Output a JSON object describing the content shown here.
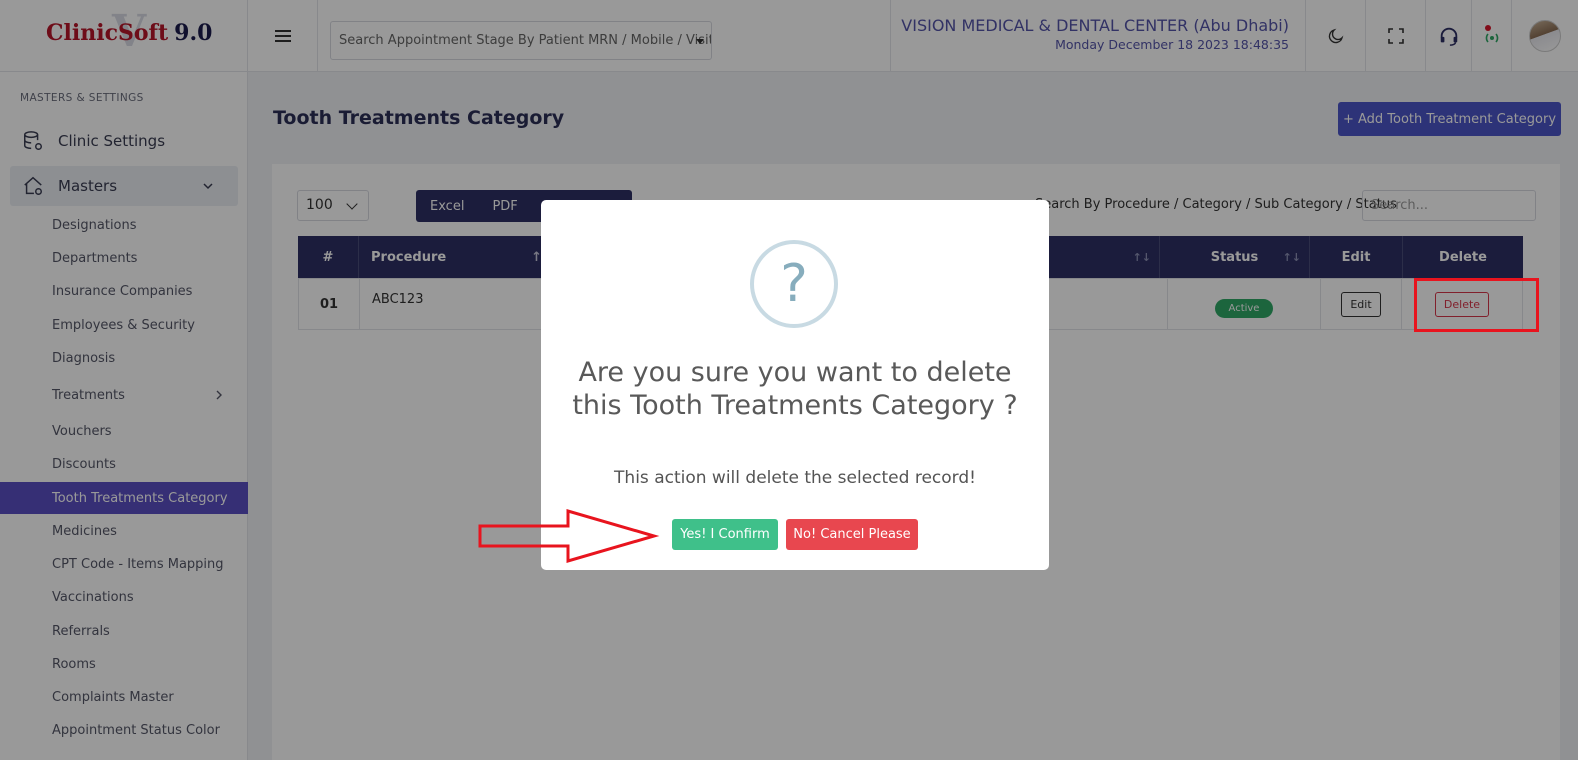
{
  "header": {
    "logo_main": "ClinicSoft",
    "logo_version": "9.0",
    "logo_watermark": "V",
    "search_placeholder": "Search Appointment Stage By Patient MRN / Mobile / Visit ID",
    "clinic_name": "VISION MEDICAL & DENTAL CENTER (Abu Dhabi)",
    "datetime": "Monday December 18 2023 18:48:35",
    "icons": [
      "menu-icon",
      "moon-icon",
      "fullscreen-icon",
      "headset-icon",
      "broadcast-icon",
      "avatar"
    ]
  },
  "sidebar": {
    "section_label": "MASTERS & SETTINGS",
    "clinic_settings": "Clinic Settings",
    "masters": "Masters",
    "items": [
      {
        "label": "Designations"
      },
      {
        "label": "Departments"
      },
      {
        "label": "Insurance Companies"
      },
      {
        "label": "Employees & Security"
      },
      {
        "label": "Diagnosis"
      },
      {
        "label": "Treatments"
      },
      {
        "label": "Vouchers"
      },
      {
        "label": "Discounts"
      },
      {
        "label": "Tooth Treatments Category"
      },
      {
        "label": "Medicines"
      },
      {
        "label": "CPT Code - Items Mapping"
      },
      {
        "label": "Vaccinations"
      },
      {
        "label": "Referrals"
      },
      {
        "label": "Rooms"
      },
      {
        "label": "Complaints Master"
      },
      {
        "label": "Appointment Status Color"
      }
    ],
    "active_item": "Tooth Treatments Category"
  },
  "main": {
    "title": "Tooth Treatments Category",
    "add_button": "+ Add Tooth Treatment Category",
    "page_length": "100",
    "export_buttons": [
      "Excel",
      "PDF"
    ],
    "search_label": "Search By Procedure / Category / Sub Category / Status",
    "search_placeholder": "Search...",
    "columns": [
      "#",
      "Procedure",
      "Status",
      "Edit",
      "Delete"
    ],
    "rows": [
      {
        "num": "01",
        "procedure": "ABC123",
        "status": "Active",
        "edit": "Edit",
        "delete": "Delete"
      }
    ]
  },
  "modal": {
    "icon": "?",
    "title": "Are you sure you want to delete this Tooth Treatments Category ?",
    "text": "This action will delete the selected record!",
    "confirm": "Yes! I Confirm",
    "cancel": "No! Cancel Please"
  },
  "colors": {
    "primary": "#2d3064",
    "accent": "#5b4fc3",
    "confirm": "#3fc08a",
    "cancel": "#e8474f",
    "annotation": "#e8141e"
  }
}
